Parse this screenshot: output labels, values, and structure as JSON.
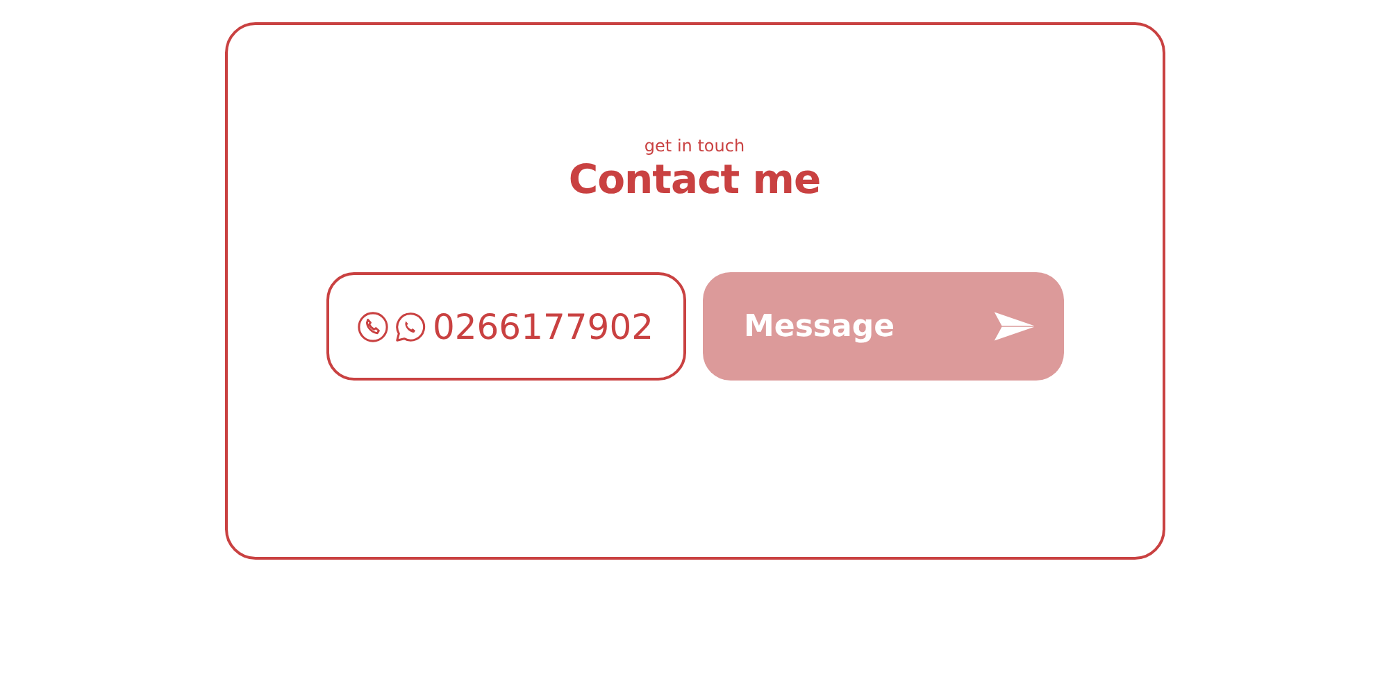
{
  "header": {
    "eyebrow": "get in touch",
    "title": "Contact me"
  },
  "phone": {
    "number": "0266177902"
  },
  "message": {
    "placeholder": "Message"
  }
}
